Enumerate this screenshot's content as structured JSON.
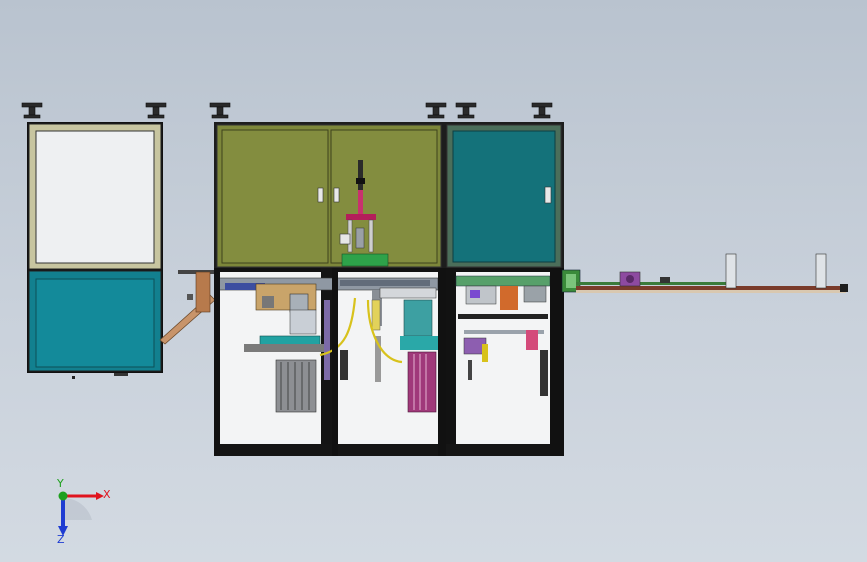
{
  "viewport": {
    "background": "#c3ccd6"
  },
  "machine": {
    "frame_color": "#1e1e1e",
    "left_cabinet": {
      "upper_panel": "#c7c5a0",
      "lower_panel": "#12808f"
    },
    "center_cabinet": {
      "door_color": "#808a3c"
    },
    "right_cabinet": {
      "door_color": "#14727a"
    },
    "conveyor": {
      "rail_color": "#7a3b2a",
      "belt_color": "#3a7a3a"
    }
  },
  "triad": {
    "x_label": "X",
    "y_label": "Y",
    "z_label": "Z",
    "x_color": "#e0141e",
    "y_color": "#1ea01e",
    "z_color": "#1e3cd2"
  }
}
